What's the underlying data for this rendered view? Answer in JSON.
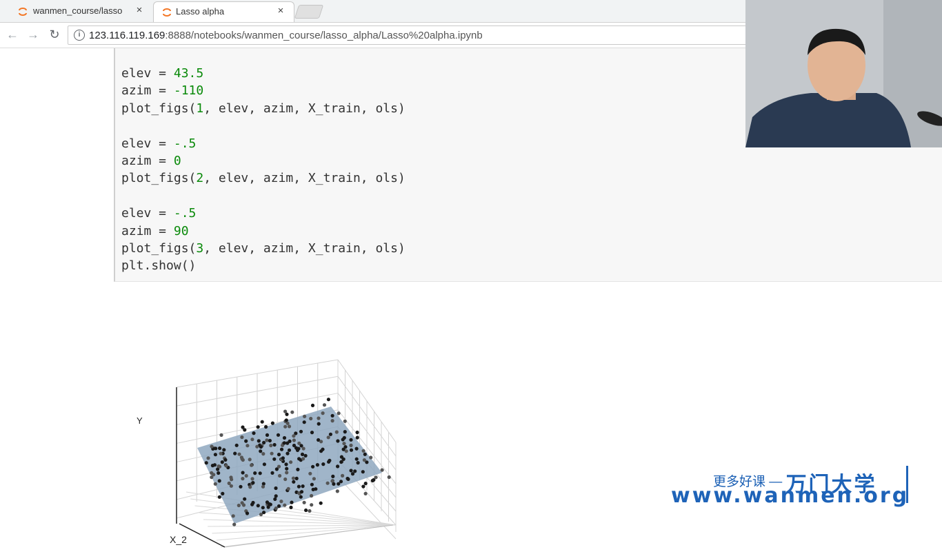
{
  "browser": {
    "tabs": [
      {
        "title": "wanmen_course/lasso",
        "active": false
      },
      {
        "title": "Lasso alpha",
        "active": true
      }
    ],
    "url_host": "123.116.119.169",
    "url_rest": ":8888/notebooks/wanmen_course/lasso_alpha/Lasso%20alpha.ipynb"
  },
  "code_lines": [
    {
      "pre": "elev = ",
      "num": "43.5",
      "post": ""
    },
    {
      "pre": "azim = ",
      "num": "-110",
      "post": ""
    },
    {
      "pre": "plot_figs(",
      "num": "1",
      "post": ", elev, azim, X_train, ols)"
    },
    {
      "pre": "",
      "num": "",
      "post": ""
    },
    {
      "pre": "elev = ",
      "num": "-.5",
      "post": ""
    },
    {
      "pre": "azim = ",
      "num": "0",
      "post": ""
    },
    {
      "pre": "plot_figs(",
      "num": "2",
      "post": ", elev, azim, X_train, ols)"
    },
    {
      "pre": "",
      "num": "",
      "post": ""
    },
    {
      "pre": "elev = ",
      "num": "-.5",
      "post": ""
    },
    {
      "pre": "azim = ",
      "num": "90",
      "post": ""
    },
    {
      "pre": "plot_figs(",
      "num": "3",
      "post": ", elev, azim, X_train, ols)"
    },
    {
      "pre": "plt.show()",
      "num": "",
      "post": ""
    }
  ],
  "plot": {
    "ylabel": "Y",
    "xlabel": "X_2",
    "plane_color": "#8fa8c0"
  },
  "watermark": {
    "line1_small": "更多好课 —",
    "line1_big": "万门大学",
    "line2": "www.wanmen.org",
    "color": "#1e63b8"
  }
}
